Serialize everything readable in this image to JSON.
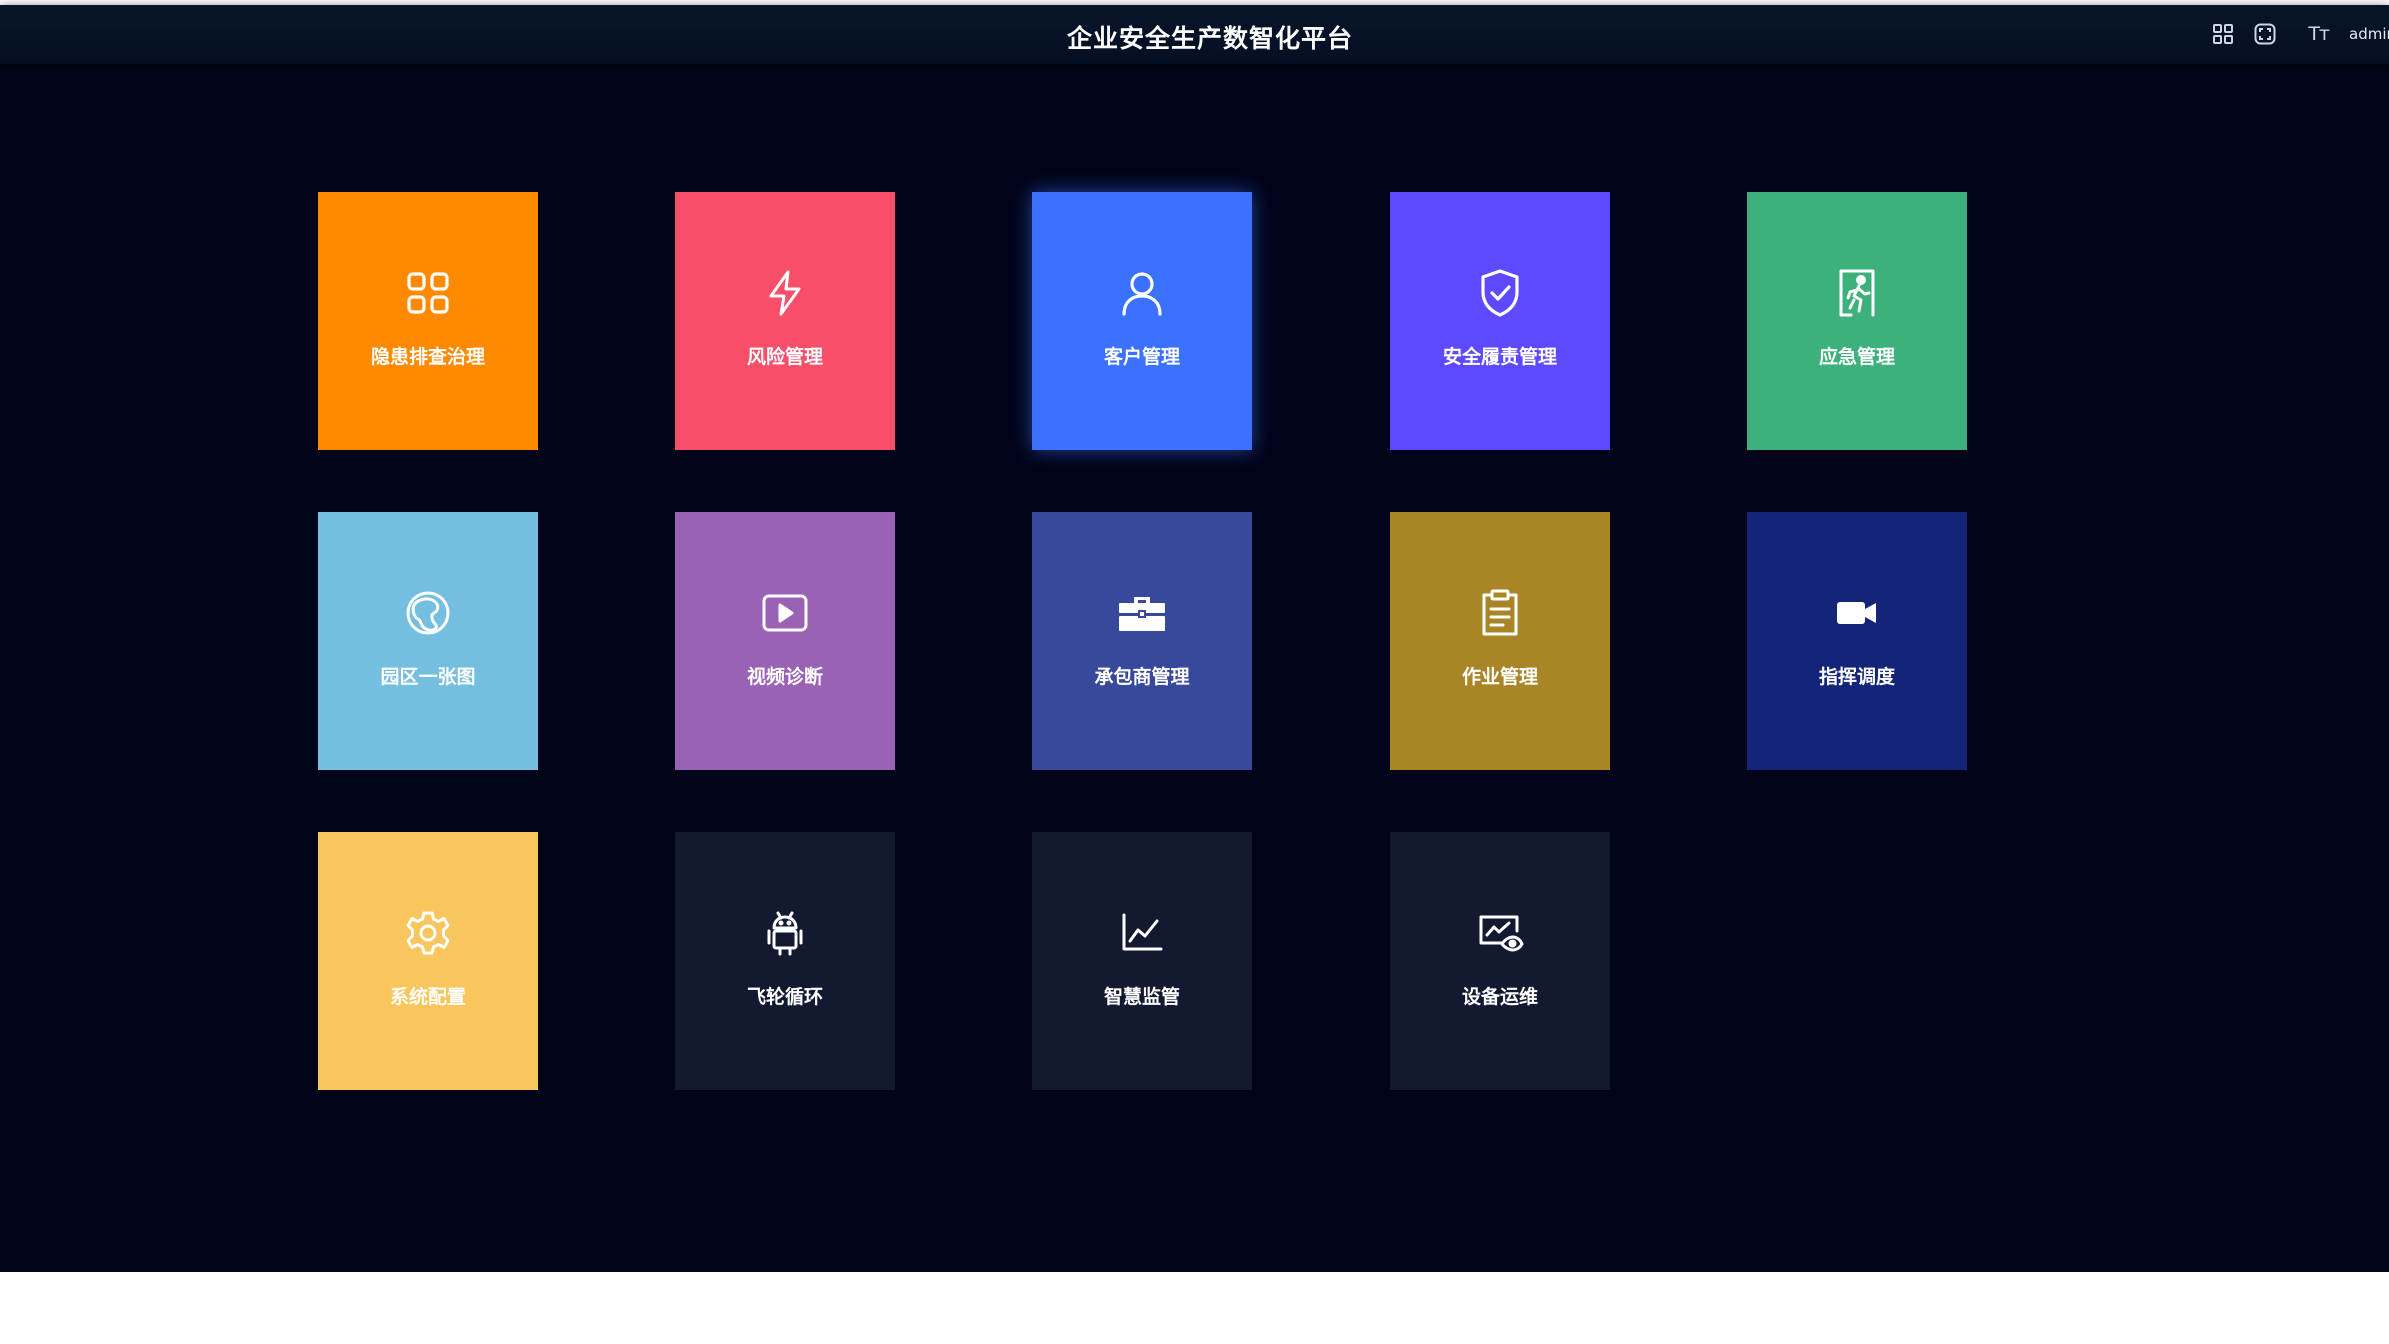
{
  "header": {
    "title": "企业安全生产数智化平台",
    "font_size_toggle": "Tт",
    "user": "admin"
  },
  "tiles": [
    {
      "label": "隐患排查治理",
      "icon": "grid-icon",
      "color": "#ff8a00"
    },
    {
      "label": "风险管理",
      "icon": "lightning-icon",
      "color": "#f74e6a"
    },
    {
      "label": "客户管理",
      "icon": "user-icon",
      "color": "#3a72ff"
    },
    {
      "label": "安全履责管理",
      "icon": "shield-check-icon",
      "color": "#5d4aff"
    },
    {
      "label": "应急管理",
      "icon": "emergency-exit-icon",
      "color": "#3eb07b"
    },
    {
      "label": "园区一张图",
      "icon": "map-globe-icon",
      "color": "#74bfdf"
    },
    {
      "label": "视频诊断",
      "icon": "video-play-icon",
      "color": "#9a62b4"
    },
    {
      "label": "承包商管理",
      "icon": "toolbox-icon",
      "color": "#38489a"
    },
    {
      "label": "作业管理",
      "icon": "clipboard-icon",
      "color": "#a88628"
    },
    {
      "label": "指挥调度",
      "icon": "video-camera-icon",
      "color": "#142478"
    },
    {
      "label": "系统配置",
      "icon": "gear-icon",
      "color": "#f8c65c"
    },
    {
      "label": "飞轮循环",
      "icon": "robot-icon",
      "color": "#131931"
    },
    {
      "label": "智慧监管",
      "icon": "line-chart-icon",
      "color": "#131931"
    },
    {
      "label": "设备运维",
      "icon": "monitor-eye-icon",
      "color": "#131931"
    }
  ]
}
